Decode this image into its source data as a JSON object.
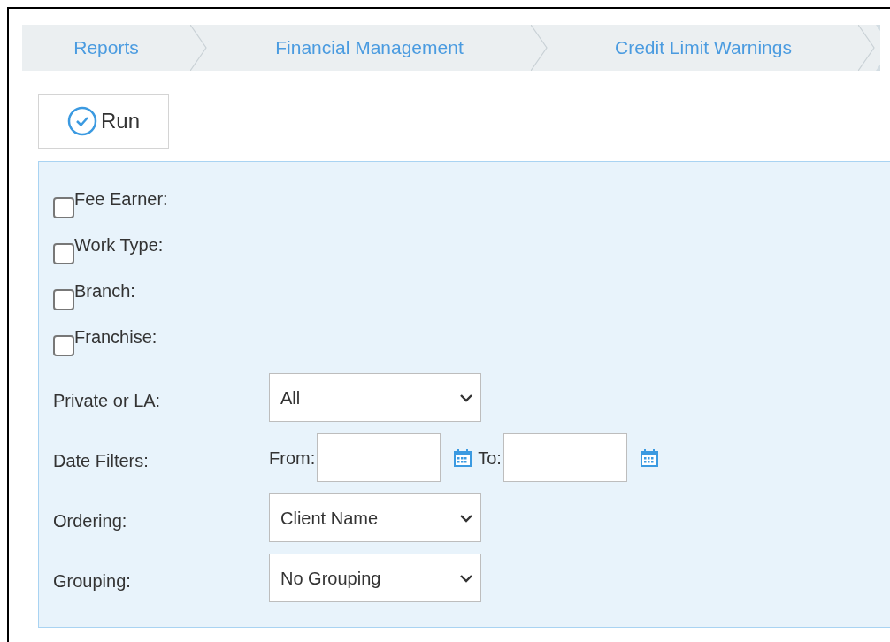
{
  "breadcrumbs": [
    {
      "label": "Reports"
    },
    {
      "label": "Financial Management"
    },
    {
      "label": "Credit Limit Warnings"
    }
  ],
  "run_button": {
    "label": "Run"
  },
  "checkbox_filters": [
    {
      "label": "Fee Earner:",
      "checked": false
    },
    {
      "label": "Work Type:",
      "checked": false
    },
    {
      "label": "Branch:",
      "checked": false
    },
    {
      "label": "Franchise:",
      "checked": false
    }
  ],
  "fields": [
    {
      "kind": "select",
      "label": "Private or LA:",
      "value": "All"
    },
    {
      "kind": "dates",
      "label": "Date Filters:",
      "from_label": "From:",
      "to_label": "To:"
    },
    {
      "kind": "select",
      "label": "Ordering:",
      "value": "Client Name"
    },
    {
      "kind": "select",
      "label": "Grouping:",
      "value": "No Grouping"
    }
  ]
}
